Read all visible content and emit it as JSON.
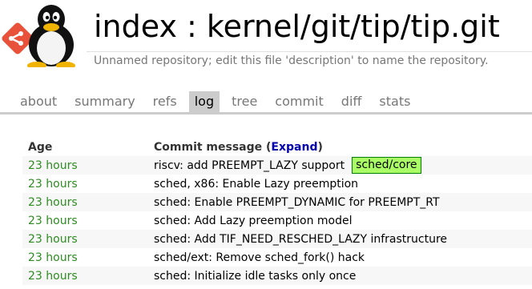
{
  "header": {
    "title": "index : kernel/git/tip/tip.git",
    "description": "Unnamed repository; edit this file 'description' to name the repository."
  },
  "tabs": [
    {
      "label": "about",
      "active": false
    },
    {
      "label": "summary",
      "active": false
    },
    {
      "label": "refs",
      "active": false
    },
    {
      "label": "log",
      "active": true
    },
    {
      "label": "tree",
      "active": false
    },
    {
      "label": "commit",
      "active": false
    },
    {
      "label": "diff",
      "active": false
    },
    {
      "label": "stats",
      "active": false
    }
  ],
  "log": {
    "col_age": "Age",
    "col_msg_prefix": "Commit message (",
    "col_msg_expand": "Expand",
    "col_msg_suffix": ")",
    "rows": [
      {
        "age": "23 hours",
        "msg": "riscv: add PREEMPT_LAZY support",
        "badge": "sched/core"
      },
      {
        "age": "23 hours",
        "msg": "sched, x86: Enable Lazy preemption"
      },
      {
        "age": "23 hours",
        "msg": "sched: Enable PREEMPT_DYNAMIC for PREEMPT_RT"
      },
      {
        "age": "23 hours",
        "msg": "sched: Add Lazy preemption model"
      },
      {
        "age": "23 hours",
        "msg": "sched: Add TIF_NEED_RESCHED_LAZY infrastructure"
      },
      {
        "age": "23 hours",
        "msg": "sched/ext: Remove sched_fork() hack"
      },
      {
        "age": "23 hours",
        "msg": "sched: Initialize idle tasks only once"
      }
    ]
  },
  "colors": {
    "age": "#2e8b22",
    "badge_bg": "#aaff66",
    "badge_border": "#008000",
    "expand_link": "#0000aa",
    "tab_active_bg": "#cccccc"
  },
  "icons": {
    "logo": "git-tux-logo-icon"
  }
}
